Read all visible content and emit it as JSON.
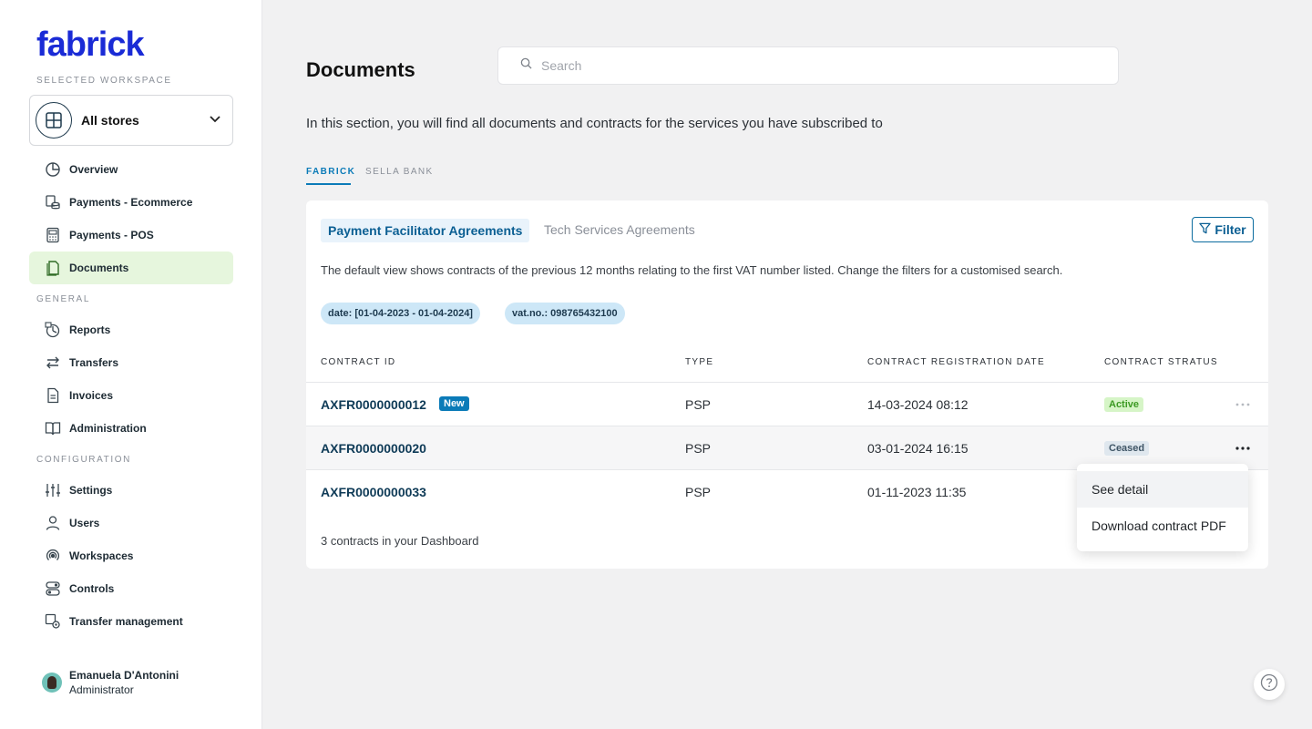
{
  "brand": {
    "name": "fabrick",
    "color": "#1a2bd6"
  },
  "sidebar": {
    "workspace_label": "SELECTED WORKSPACE",
    "workspace_value": "All stores",
    "items_top": [
      {
        "label": "Overview",
        "icon": "pie-chart-icon"
      },
      {
        "label": "Payments - Ecommerce",
        "icon": "coins-icon"
      },
      {
        "label": "Payments - POS",
        "icon": "pos-terminal-icon"
      },
      {
        "label": "Documents",
        "icon": "document-icon",
        "active": true
      }
    ],
    "general_label": "GENERAL",
    "items_general": [
      {
        "label": "Reports",
        "icon": "reports-icon"
      },
      {
        "label": "Transfers",
        "icon": "transfer-arrows-icon"
      },
      {
        "label": "Invoices",
        "icon": "invoice-icon"
      },
      {
        "label": "Administration",
        "icon": "book-icon"
      }
    ],
    "config_label": "CONFIGURATION",
    "items_config": [
      {
        "label": "Settings",
        "icon": "sliders-icon"
      },
      {
        "label": "Users",
        "icon": "user-icon"
      },
      {
        "label": "Workspaces",
        "icon": "workspaces-icon"
      },
      {
        "label": "Controls",
        "icon": "toggles-icon"
      },
      {
        "label": "Transfer management",
        "icon": "transfer-settings-icon"
      }
    ],
    "user": {
      "name": "Emanuela D'Antonini",
      "role": "Administrator"
    }
  },
  "header": {
    "title": "Documents",
    "search_placeholder": "Search"
  },
  "intro": "In this section, you will find all documents and contracts for the services you have subscribed to",
  "top_tabs": [
    {
      "label": "FABRICK",
      "active": true
    },
    {
      "label": "SELLA BANK",
      "active": false
    }
  ],
  "card": {
    "sub_tabs": [
      {
        "label": "Payment Facilitator Agreements",
        "active": true
      },
      {
        "label": "Tech Services Agreements",
        "active": false
      }
    ],
    "filter_label": "Filter",
    "description": "The default view shows contracts of the previous 12 months relating to the first VAT number listed. Change the filters for a customised search.",
    "chips": [
      "date: [01-04-2023 - 01-04-2024]",
      "vat.no.: 098765432100"
    ],
    "columns": [
      "CONTRACT ID",
      "TYPE",
      "CONTRACT REGISTRATION DATE",
      "CONTRACT STRATUS"
    ],
    "rows": [
      {
        "id": "AXFR0000000012",
        "badge": "New",
        "type": "PSP",
        "date": "14-03-2024 08:12",
        "status": "Active"
      },
      {
        "id": "AXFR0000000020",
        "badge": "",
        "type": "PSP",
        "date": "03-01-2024 16:15",
        "status": "Ceased"
      },
      {
        "id": "AXFR0000000033",
        "badge": "",
        "type": "PSP",
        "date": "01-11-2023 11:35",
        "status": ""
      }
    ],
    "footer": "3 contracts in your Dashboard"
  },
  "context_menu": {
    "items": [
      "See detail",
      "Download contract PDF"
    ]
  },
  "colors": {
    "accent": "#0b7bb8",
    "active_nav_bg": "#e6f6dd",
    "status_active": "#3c9a23",
    "status_ceased": "#3f5566"
  }
}
